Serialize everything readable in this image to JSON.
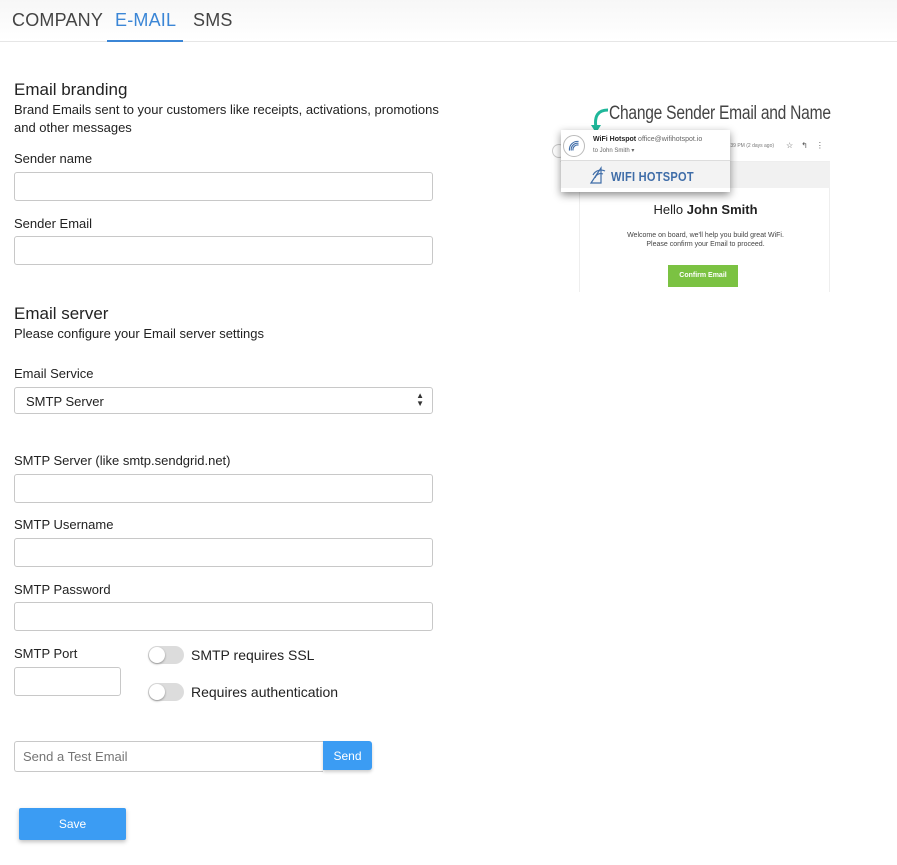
{
  "tabs": [
    {
      "label": "COMPANY",
      "active": false
    },
    {
      "label": "E-MAIL",
      "active": true
    },
    {
      "label": "SMS",
      "active": false
    }
  ],
  "branding": {
    "title": "Email branding",
    "description_line1": "Brand Emails sent to your customers like receipts, activations, promotions",
    "description_line2": "and other messages",
    "sender_name_label": "Sender name",
    "sender_name_value": "",
    "sender_email_label": "Sender Email",
    "sender_email_value": ""
  },
  "server": {
    "title": "Email server",
    "description": "Please configure your Email server settings",
    "service_label": "Email Service",
    "service_selected": "SMTP Server",
    "smtp_server_label": "SMTP Server (like smtp.sendgrid.net)",
    "smtp_server_value": "",
    "smtp_username_label": "SMTP Username",
    "smtp_username_value": "",
    "smtp_password_label": "SMTP Password",
    "smtp_password_value": "",
    "smtp_port_label": "SMTP Port",
    "smtp_port_value": "",
    "ssl_label": "SMTP requires SSL",
    "ssl_on": false,
    "auth_label": "Requires authentication",
    "auth_on": false
  },
  "test": {
    "placeholder": "Send a Test Email",
    "send_label": "Send"
  },
  "save_label": "Save",
  "preview": {
    "title": "Change Sender Email and Name",
    "from_name": "WiFi Hotspot",
    "from_address": "office@wifihotspot.io",
    "to_line": "to John Smith",
    "logo_text": "WIFI HOTSPOT",
    "meta_time": ":39 PM (2 days ago)",
    "hello": "Hello",
    "hello_name": "John Smith",
    "message_line1": "Welcome on board, we'll help you build great WiFi.",
    "message_line2": "Please confirm your Email to proceed.",
    "button_label": "Confirm Email"
  },
  "colors": {
    "accent": "#3b86d6",
    "button": "#3b9cf3",
    "confirm_green": "#7bc242",
    "arrow_teal": "#1fb79a"
  }
}
